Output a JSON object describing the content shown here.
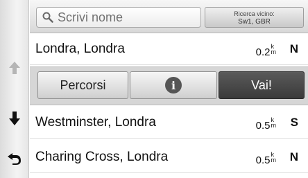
{
  "search": {
    "placeholder": "Scrivi nome",
    "icon": "magnifier-icon"
  },
  "nearby": {
    "label": "Ricerca vicino:",
    "value": "Sw1, GBR"
  },
  "results": [
    {
      "name": "Londra, Londra",
      "distance": "0.2",
      "unit_top": "k",
      "unit_bottom": "m",
      "direction": "N"
    },
    {
      "name": "Westminster, Londra",
      "distance": "0.5",
      "unit_top": "k",
      "unit_bottom": "m",
      "direction": "S"
    },
    {
      "name": "Charing Cross, Londra",
      "distance": "0.5",
      "unit_top": "k",
      "unit_bottom": "m",
      "direction": "N"
    }
  ],
  "actions": {
    "routes_label": "Percorsi",
    "info_symbol": "i",
    "go_label": "Vai!"
  },
  "rail": {
    "icons": [
      "arrow-up-icon",
      "arrow-down-icon",
      "back-icon"
    ]
  },
  "colors": {
    "accent_dark": "#3f3f3f",
    "disabled_arrow": "#b5b5b5"
  }
}
